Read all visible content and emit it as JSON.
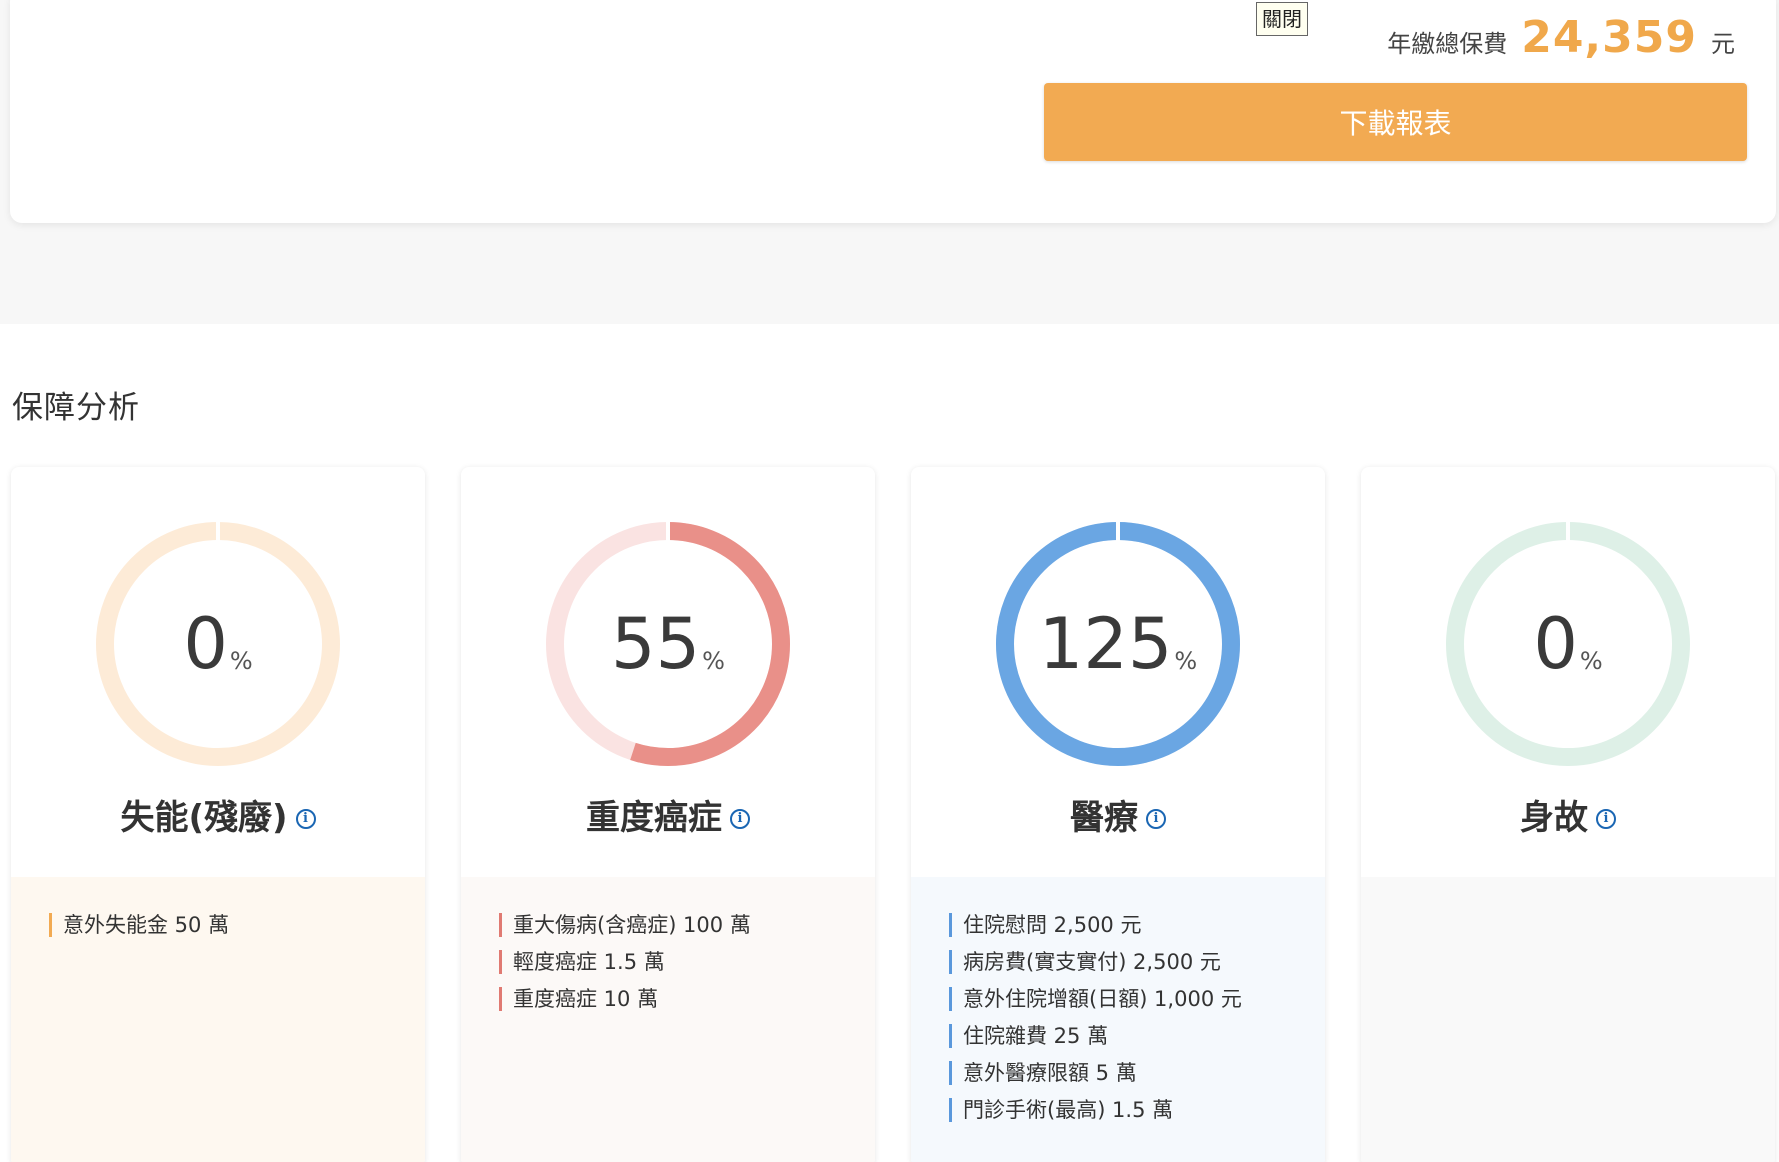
{
  "summary": {
    "close_label": "關閉",
    "premium_label": "年繳總保費",
    "premium_amount": "24,359",
    "premium_unit": "元",
    "download_label": "下載報表"
  },
  "section_title": "保障分析",
  "percent_sign": "%",
  "cards": [
    {
      "title": "失能(殘廢)",
      "value": "0",
      "percent": 0,
      "ring_color": "#f5b868",
      "track_color": "#fdebd7",
      "list_bg": "#fef8f0",
      "bar_color": "#f2aa52",
      "items": [
        "意外失能金 50 萬"
      ]
    },
    {
      "title": "重度癌症",
      "value": "55",
      "percent": 55,
      "ring_color": "#e99089",
      "track_color": "#fae3e2",
      "list_bg": "#fcf9f7",
      "bar_color": "#e07a72",
      "items": [
        "重大傷病(含癌症) 100 萬",
        "輕度癌症 1.5 萬",
        "重度癌症 10 萬"
      ]
    },
    {
      "title": "醫療",
      "value": "125",
      "percent": 125,
      "ring_color": "#6aa6e3",
      "track_color": "#d8e8f8",
      "list_bg": "#f5f9fd",
      "bar_color": "#5a98dc",
      "items": [
        "住院慰問 2,500 元",
        "病房費(實支實付) 2,500 元",
        "意外住院增額(日額) 1,000 元",
        "住院雜費 25 萬",
        "意外醫療限額 5 萬",
        "門診手術(最高) 1.5 萬"
      ]
    },
    {
      "title": "身故",
      "value": "0",
      "percent": 0,
      "ring_color": "#9fd4b9",
      "track_color": "#def0e7",
      "list_bg": "#f9f9f9",
      "bar_color": "#7cc3a0",
      "items": []
    }
  ]
}
